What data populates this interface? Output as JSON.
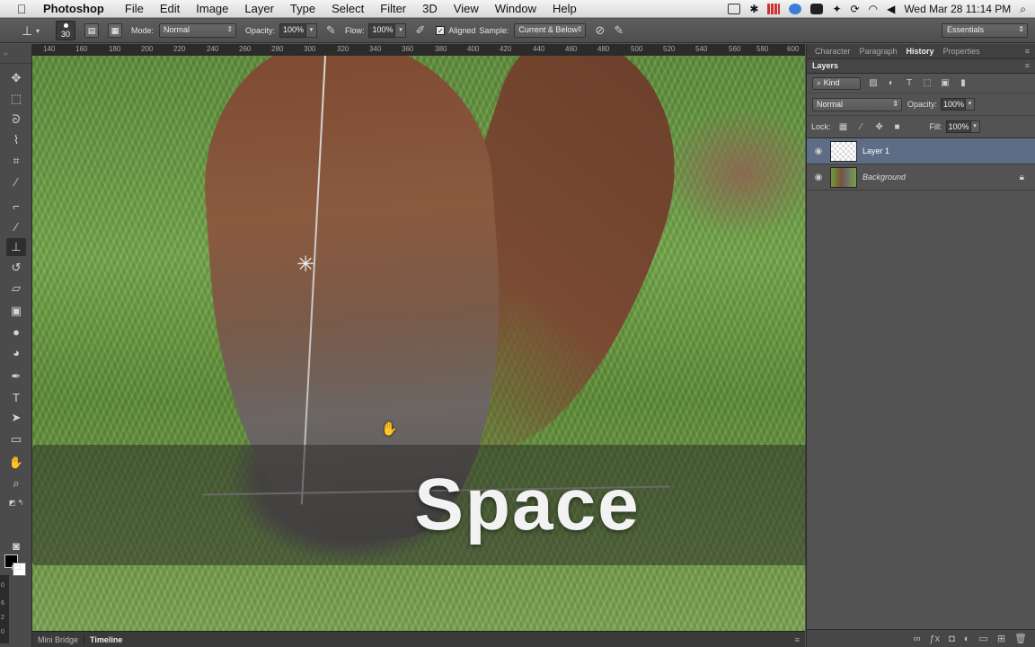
{
  "menubar": {
    "apple": "",
    "app_name": "Photoshop",
    "items": [
      "File",
      "Edit",
      "Image",
      "Layer",
      "Type",
      "Select",
      "Filter",
      "3D",
      "View",
      "Window",
      "Help"
    ],
    "clock": "Wed Mar 28  11:14 PM"
  },
  "options": {
    "brush_size": "30",
    "mode_label": "Mode:",
    "mode_value": "Normal",
    "opacity_label": "Opacity:",
    "opacity_value": "100%",
    "flow_label": "Flow:",
    "flow_value": "100%",
    "aligned_label": "Aligned",
    "sample_label": "Sample:",
    "sample_value": "Current & Below",
    "workspace": "Essentials"
  },
  "ruler": {
    "top_ticks": [
      "140",
      "160",
      "180",
      "200",
      "220",
      "240",
      "260",
      "280",
      "300",
      "320",
      "340",
      "360",
      "380",
      "400",
      "420",
      "440",
      "460",
      "480",
      "500",
      "520",
      "540",
      "560",
      "580",
      "600"
    ],
    "left_ticks": [
      "0",
      "6",
      "2",
      "0"
    ]
  },
  "keystroke_overlay": "Space",
  "bottom_tabs": [
    "Mini Bridge",
    "Timeline"
  ],
  "panels": {
    "top_tabs": [
      "Character",
      "Paragraph",
      "History",
      "Properties"
    ],
    "active_top_tab": "History",
    "layers_title": "Layers",
    "filter_kind": "Kind",
    "blend_mode": "Normal",
    "opacity_label": "Opacity:",
    "opacity_value": "100%",
    "lock_label": "Lock:",
    "fill_label": "Fill:",
    "fill_value": "100%",
    "layers": [
      {
        "name": "Layer 1",
        "selected": true
      },
      {
        "name": "Background",
        "selected": false
      }
    ]
  }
}
